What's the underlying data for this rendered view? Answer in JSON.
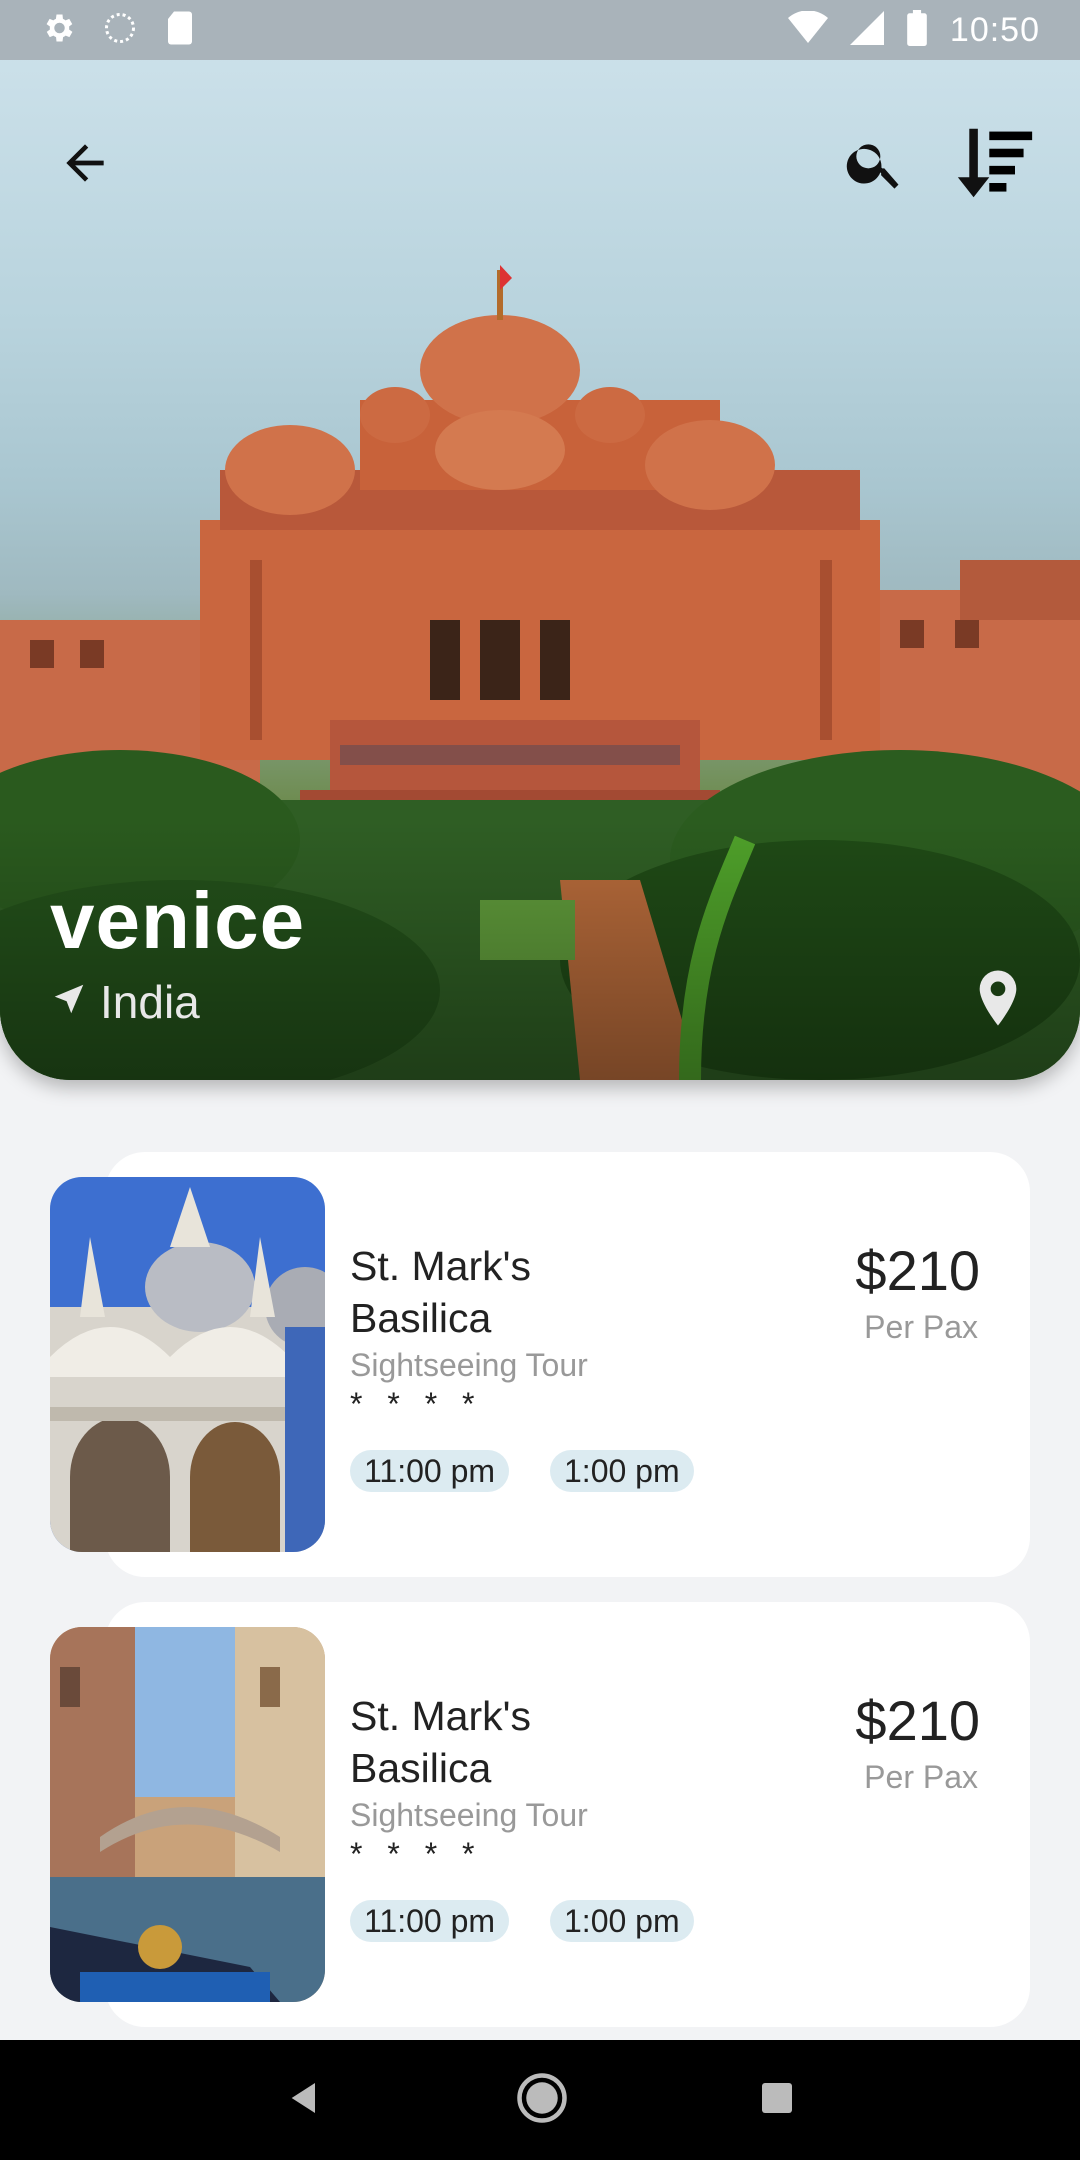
{
  "status_bar": {
    "time": "10:50"
  },
  "hero": {
    "title": "venice",
    "location": "India"
  },
  "tours": [
    {
      "title": "St. Mark's Basilica",
      "category": "Sightseeing Tour",
      "rating_text": "* * * *",
      "price": "$210",
      "price_unit": "Per Pax",
      "times": [
        "11:00 pm",
        "1:00 pm"
      ]
    },
    {
      "title": "St. Mark's Basilica",
      "category": "Sightseeing Tour",
      "rating_text": "* * * *",
      "price": "$210",
      "price_unit": "Per Pax",
      "times": [
        "11:00 pm",
        "1:00 pm"
      ]
    }
  ],
  "colors": {
    "chip_bg": "#dcebf1",
    "card_bg": "#ffffff",
    "page_bg": "#f2f3f5",
    "temple": "#c8623a"
  }
}
